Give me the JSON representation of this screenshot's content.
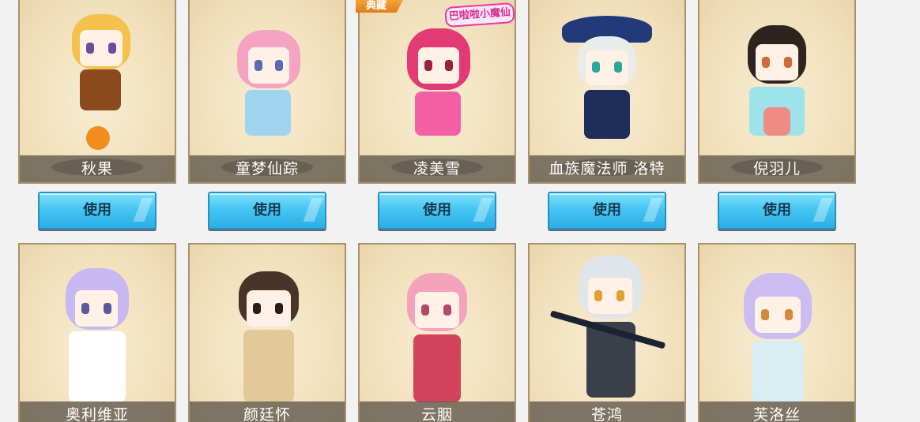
{
  "row1": [
    {
      "name": "秋果",
      "hair": "#f4c24c",
      "outfit": "#8b4a1e",
      "accent": "#f28c1f"
    },
    {
      "name": "童梦仙踪",
      "hair": "#f4a3c2",
      "outfit": "#9fd3ee",
      "accent": "#ffffff"
    },
    {
      "name": "凌美雪",
      "hair": "#e23a73",
      "outfit": "#f55fa6",
      "accent": "#ffd0e6"
    },
    {
      "name": "血族魔法师 洛特",
      "hair": "#e8ecea",
      "outfit": "#1f2d5a",
      "accent": "#3a6aa8"
    },
    {
      "name": "倪羽儿",
      "hair": "#2d2420",
      "outfit": "#9fe3ea",
      "accent": "#f08a84"
    }
  ],
  "row2": [
    {
      "name": "奥利维亚",
      "hair": "#c8b8f2",
      "outfit": "#ffffff",
      "accent": "#3a3a3a"
    },
    {
      "name": "颜廷怀",
      "hair": "#4a3428",
      "outfit": "#e3c89a",
      "accent": "#c77b3a"
    },
    {
      "name": "云胭",
      "hair": "#f4a3bd",
      "outfit": "#d1445c",
      "accent": "#f6e3ea"
    },
    {
      "name": "苍鸿",
      "hair": "#dfe6ea",
      "outfit": "#3a3f4a",
      "accent": "#f2d04a"
    },
    {
      "name": "芙洛丝",
      "hair": "#cbbcf2",
      "outfit": "#d8eef0",
      "accent": "#5b4a9a"
    }
  ],
  "buttons": {
    "use_label": "使用"
  },
  "badge": {
    "label": "典藏"
  },
  "logo": {
    "label": "巴啦啦小魔仙"
  }
}
